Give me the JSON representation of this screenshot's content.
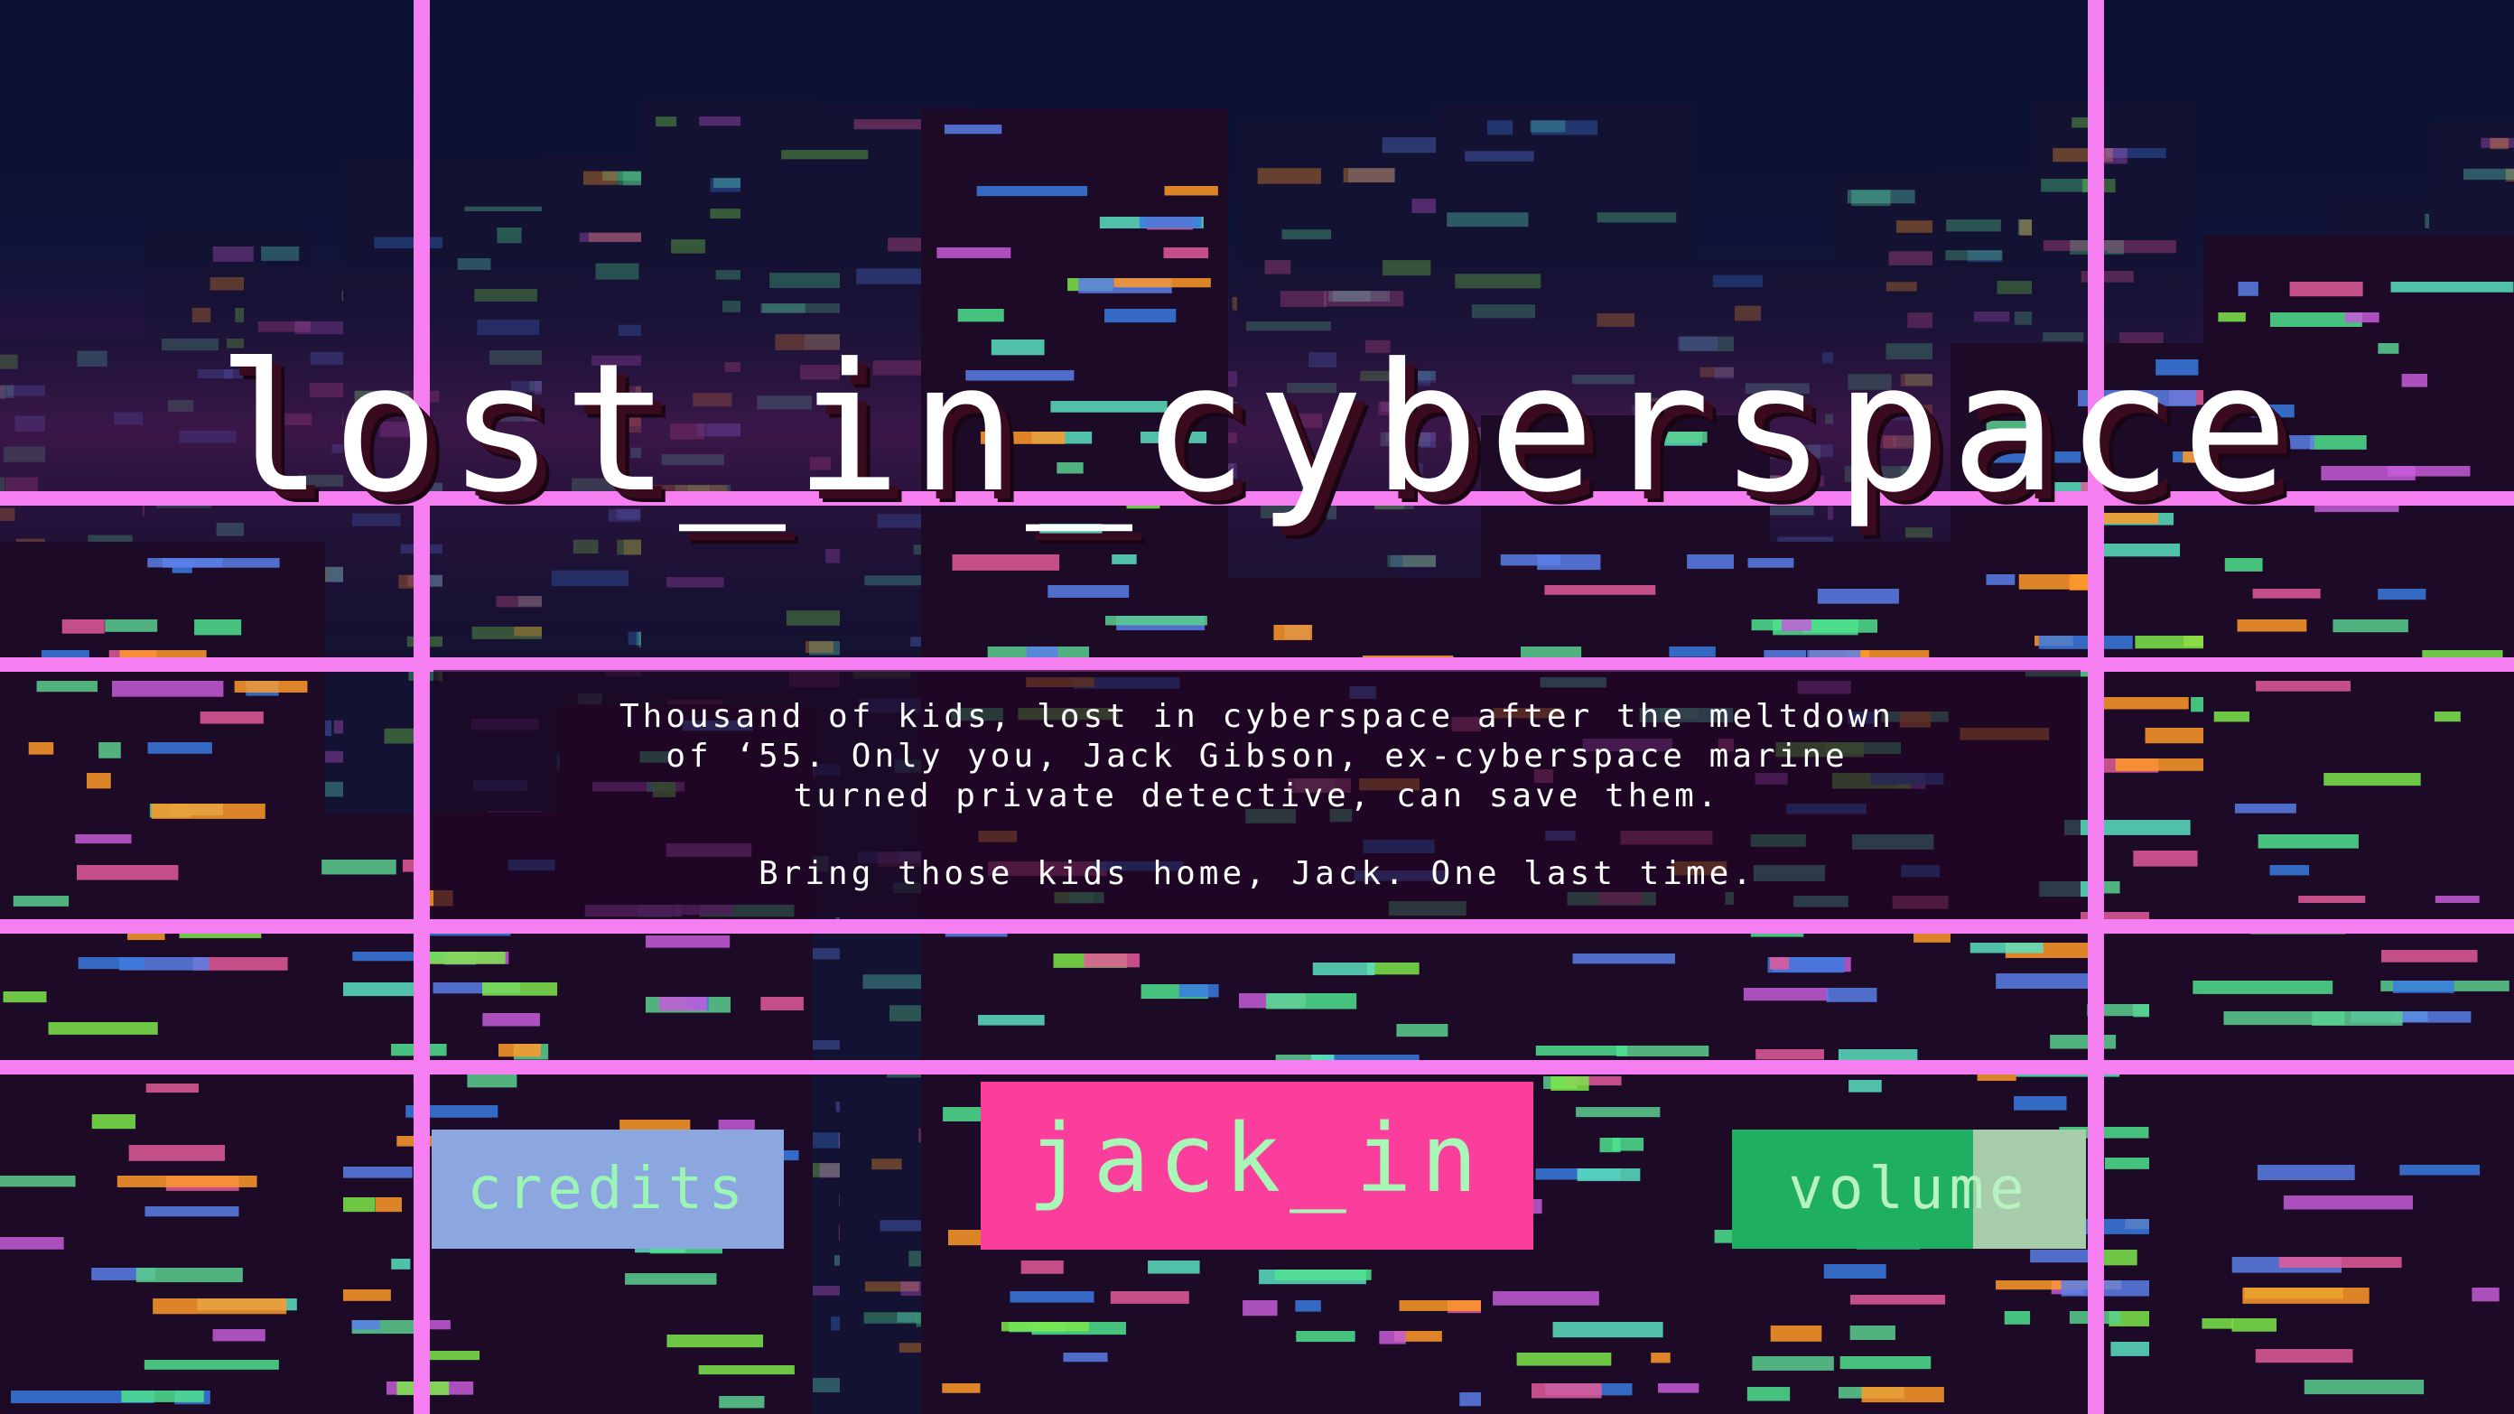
{
  "title": "lost_in_cyberspace",
  "story": {
    "paragraph1": [
      "Thousand of kids, lost in cyberspace after the meltdown",
      "of ‘55. Only you, Jack Gibson, ex-cyberspace marine",
      "turned private detective, can save them."
    ],
    "paragraph2": "Bring those kids home, Jack. One last time."
  },
  "menu": {
    "credits_label": "credits",
    "jack_in_label": "jack_in",
    "volume_label": "volume",
    "volume_level": 0.68
  },
  "colors": {
    "grid": "#f57ef0",
    "credits_bg": "#8ca7e0",
    "jack_in_bg": "#fb3d9b",
    "volume_fill": "#1faf63",
    "volume_track": "#a7ccaa",
    "button_text": "#9bf5b4"
  }
}
